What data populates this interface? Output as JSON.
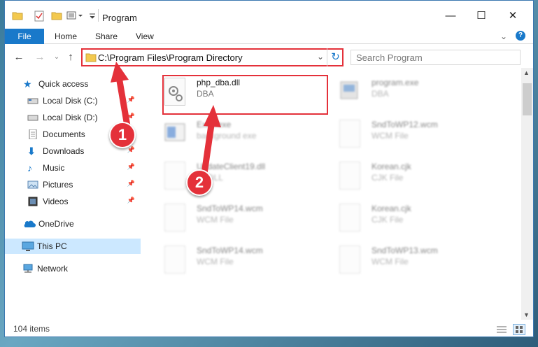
{
  "window": {
    "title": "Program",
    "controls": {
      "minimize": "—",
      "maximize": "☐",
      "close": "✕"
    }
  },
  "ribbon": {
    "file": "File",
    "tabs": [
      "Home",
      "Share",
      "View"
    ]
  },
  "navigation": {
    "address": "C:\\Program Files\\Program Directory",
    "search_placeholder": "Search Program"
  },
  "sidebar": {
    "items": [
      {
        "label": "Quick access",
        "icon": "star-icon",
        "pinned": false
      },
      {
        "label": "Local Disk (C:)",
        "icon": "drive-icon",
        "pinned": true
      },
      {
        "label": "Local Disk (D:)",
        "icon": "drive-icon",
        "pinned": true
      },
      {
        "label": "Documents",
        "icon": "document-icon",
        "pinned": true
      },
      {
        "label": "Downloads",
        "icon": "download-icon",
        "pinned": true
      },
      {
        "label": "Music",
        "icon": "music-icon",
        "pinned": true
      },
      {
        "label": "Pictures",
        "icon": "pictures-icon",
        "pinned": true
      },
      {
        "label": "Videos",
        "icon": "video-icon",
        "pinned": true
      },
      {
        "label": "OneDrive",
        "icon": "cloud-icon",
        "pinned": false
      },
      {
        "label": "This PC",
        "icon": "computer-icon",
        "pinned": false,
        "selected": true
      },
      {
        "label": "Network",
        "icon": "network-icon",
        "pinned": false
      }
    ]
  },
  "files": [
    {
      "name": "php_dba.dll",
      "type": "DBA",
      "highlighted": true
    },
    {
      "name": "program.exe",
      "type": "DBA"
    },
    {
      "name": "Exec.exe",
      "type": "background exe"
    },
    {
      "name": "SndToWP12.wcm",
      "type": "WCM File"
    },
    {
      "name": "UpdateClient19.dll",
      "type": "ce DLL"
    },
    {
      "name": "Korean.cjk",
      "type": "CJK File"
    },
    {
      "name": "SndToWP14.wcm",
      "type": "WCM File"
    },
    {
      "name": "Korean.cjk",
      "type": "CJK File"
    },
    {
      "name": "SndToWP14.wcm",
      "type": "WCM File"
    },
    {
      "name": "SndToWP13.wcm",
      "type": "WCM File"
    }
  ],
  "status": {
    "item_count": "104 items"
  },
  "callouts": [
    "1",
    "2"
  ],
  "colors": {
    "accent": "#1979ca",
    "highlight": "#e4313a"
  }
}
